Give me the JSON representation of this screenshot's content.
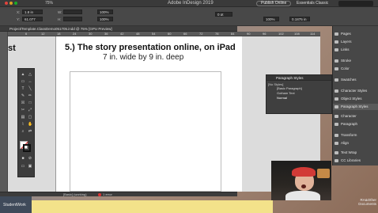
{
  "app": {
    "title": "Adobe InDesign 2019",
    "zoom": "75%",
    "publish_label": "Publish Online",
    "workspace": "Essentials Classic"
  },
  "control": {
    "x_label": "X:",
    "x_value": "1.8 in",
    "y_label": "Y:",
    "y_value": "61.077",
    "w_label": "W:",
    "w_value": "",
    "h_label": "H:",
    "h_value": "",
    "pct1": "100%",
    "pct2": "100%",
    "stroke_weight": "0 pt",
    "pct3": "100%",
    "width_val": "0.1875 in"
  },
  "document": {
    "tab_title": "Project/Template.ClassDemo051705.indd @ 75% [GPU Preview]"
  },
  "ruler": {
    "ticks": [
      "6",
      "12",
      "18",
      "24",
      "30",
      "36",
      "42",
      "48",
      "54",
      "60",
      "66",
      "72",
      "78",
      "84",
      "90",
      "96",
      "102",
      "108",
      "114"
    ]
  },
  "page": {
    "left_word": "st",
    "heading": "5.) The story presentation online, on iPad",
    "subheading": "7 in. wide by 9 in. deep"
  },
  "status": {
    "profile": "[Basic] (working)",
    "errors": "1 error"
  },
  "paragraph_styles_panel": {
    "tabs": "Paragraph Styles",
    "no_styles": "[No Styles]",
    "items": [
      "[Basic Paragraph]",
      "Gotham Text",
      "Normal"
    ]
  },
  "right_dock": {
    "items": [
      {
        "label": "Pages",
        "icon": "pages-icon"
      },
      {
        "label": "Layers",
        "icon": "layers-icon"
      },
      {
        "label": "Links",
        "icon": "links-icon"
      },
      {
        "label": "Stroke",
        "icon": "stroke-icon"
      },
      {
        "label": "Color",
        "icon": "color-icon"
      },
      {
        "label": "Swatches",
        "icon": "swatches-icon"
      },
      {
        "label": "Character Styles",
        "icon": "character-styles-icon"
      },
      {
        "label": "Object Styles",
        "icon": "object-styles-icon"
      },
      {
        "label": "Paragraph Styles",
        "icon": "paragraph-styles-icon"
      },
      {
        "label": "Character",
        "icon": "character-icon"
      },
      {
        "label": "Paragraph",
        "icon": "paragraph-icon"
      },
      {
        "label": "Transform",
        "icon": "transform-icon"
      },
      {
        "label": "Align",
        "icon": "align-icon"
      },
      {
        "label": "Text Wrap",
        "icon": "text-wrap-icon"
      },
      {
        "label": "CC Libraries",
        "icon": "cc-libraries-icon"
      }
    ]
  },
  "dock": {
    "left_label": "StudentWork",
    "right_label": "RA&Other Documents"
  },
  "colors": {
    "accent_red": "#d23a36",
    "panel_bg": "#474747",
    "dock_yellow": "#f3e28a"
  }
}
